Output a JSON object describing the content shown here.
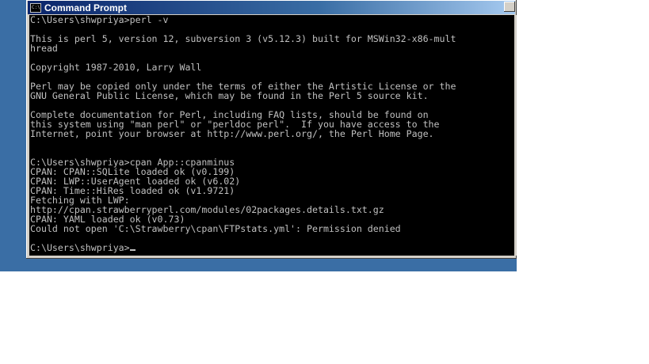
{
  "window": {
    "title": "Command Prompt",
    "icon": "cmd-icon",
    "icon_text": "C:\\"
  },
  "console": {
    "lines": [
      "C:\\Users\\shwpriya>perl -v",
      "",
      "This is perl 5, version 12, subversion 3 (v5.12.3) built for MSWin32-x86-mult",
      "hread",
      "",
      "Copyright 1987-2010, Larry Wall",
      "",
      "Perl may be copied only under the terms of either the Artistic License or the",
      "GNU General Public License, which may be found in the Perl 5 source kit.",
      "",
      "Complete documentation for Perl, including FAQ lists, should be found on",
      "this system using \"man perl\" or \"perldoc perl\".  If you have access to the",
      "Internet, point your browser at http://www.perl.org/, the Perl Home Page.",
      "",
      "",
      "C:\\Users\\shwpriya>cpan App::cpanminus",
      "CPAN: CPAN::SQLite loaded ok (v0.199)",
      "CPAN: LWP::UserAgent loaded ok (v6.02)",
      "CPAN: Time::HiRes loaded ok (v1.9721)",
      "Fetching with LWP:",
      "http://cpan.strawberryperl.com/modules/02packages.details.txt.gz",
      "CPAN: YAML loaded ok (v0.73)",
      "Could not open 'C:\\Strawberry\\cpan\\FTPstats.yml': Permission denied",
      "",
      "C:\\Users\\shwpriya>"
    ]
  }
}
